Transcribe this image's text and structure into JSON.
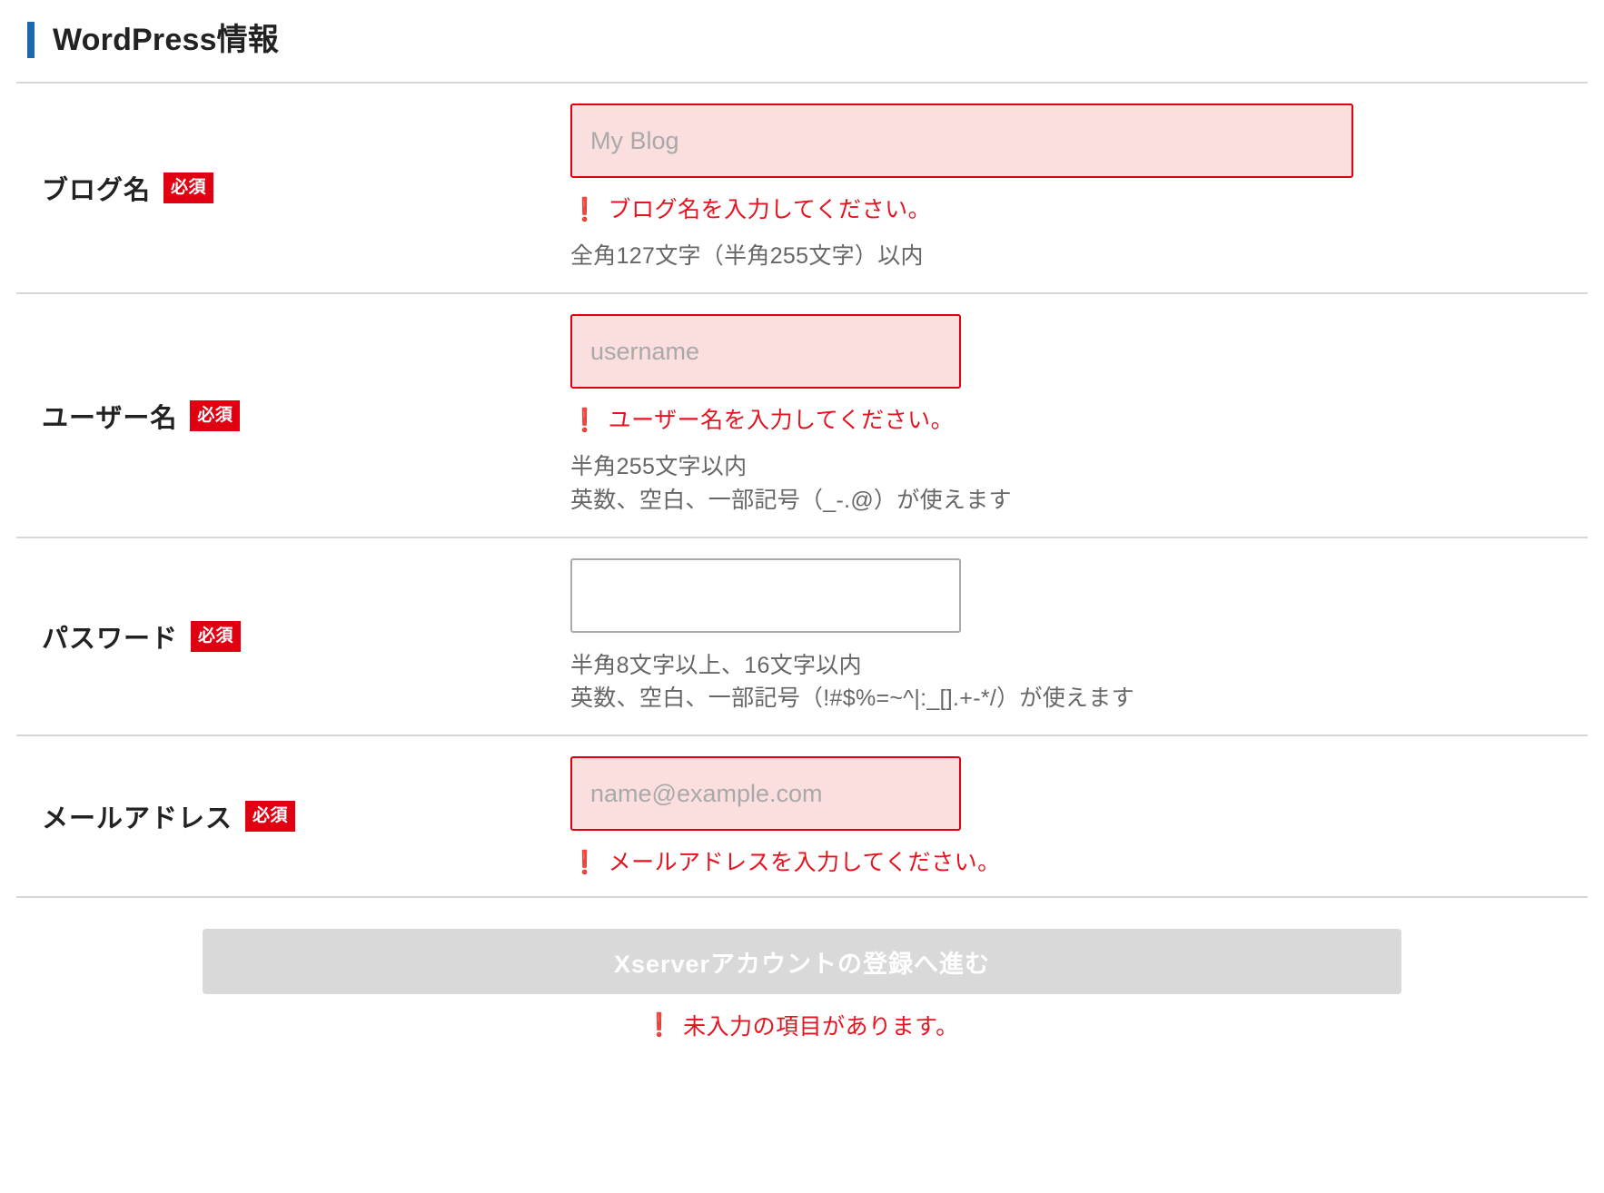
{
  "header": {
    "title": "WordPress情報",
    "accent_color": "#1d68ab"
  },
  "colors": {
    "required_badge_bg": "#e00012",
    "error_text": "#e8121f",
    "error_field_bg": "#fbdede",
    "error_field_border": "#e00012",
    "hint_text": "#666666",
    "disabled_button_bg": "#d9d9d9",
    "divider": "#d6d6d6"
  },
  "required_badge_label": "必須",
  "error_icon": "❗",
  "fields": [
    {
      "label": "ブログ名",
      "required": true,
      "placeholder": "My Blog",
      "value": "",
      "has_error": true,
      "error": "ブログ名を入力してください。",
      "hints": [
        "全角127文字（半角255文字）以内"
      ]
    },
    {
      "label": "ユーザー名",
      "required": true,
      "placeholder": "username",
      "value": "",
      "has_error": true,
      "error": "ユーザー名を入力してください。",
      "hints": [
        "半角255文字以内",
        "英数、空白、一部記号（_-.@）が使えます"
      ]
    },
    {
      "label": "パスワード",
      "required": true,
      "placeholder": "",
      "value": "",
      "has_error": false,
      "error": "",
      "hints": [
        "半角8文字以上、16文字以内",
        "英数、空白、一部記号（!#$%=~^|:_[].+-*/）が使えます"
      ]
    },
    {
      "label": "メールアドレス",
      "required": true,
      "placeholder": "name@example.com",
      "value": "",
      "has_error": true,
      "error": "メールアドレスを入力してください。",
      "hints": []
    }
  ],
  "submit": {
    "label": "Xserverアカウントの登録へ進む",
    "disabled": true,
    "error": "未入力の項目があります。"
  }
}
